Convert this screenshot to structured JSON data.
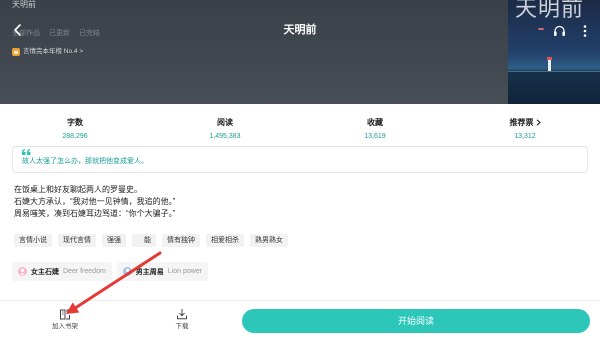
{
  "status_bar": {
    "left_text": "天明前",
    "right_icon": "signal-icon"
  },
  "header": {
    "title": "天明前",
    "back_icon": "back-arrow-icon",
    "audio_icon": "headphones-icon",
    "more_icon": "more-vertical-icon"
  },
  "author_works": {
    "tabs": [
      "全部作品",
      "已更新",
      "已完结"
    ]
  },
  "rank_badge": {
    "icon": "rank-badge-icon",
    "text": "言情完本年榜 No.4 >"
  },
  "cover": {
    "title": "天明前"
  },
  "stats": [
    {
      "label": "字数",
      "value": "288,296"
    },
    {
      "label": "阅读",
      "value": "1,495,383"
    },
    {
      "label": "收藏",
      "value": "13,619"
    },
    {
      "label": "推荐票",
      "value": "13,312",
      "icon": "chevron-right-icon"
    }
  ],
  "quote": {
    "icon": "quote-icon",
    "text": "故人太强了怎么办，那就把他变成爱人。"
  },
  "description": {
    "lines": [
      "在饭桌上和好友聊起两人的罗曼史。",
      "石婕大方承认，“我对他一见钟情，我追的他。”",
      "周易嗤笑，凑到石婕耳边骂道：“你个大骗子。”"
    ]
  },
  "tags": [
    "言情小说",
    "现代言情",
    "强强",
    "能",
    "情有独钟",
    "相爱相杀",
    "熟男熟女"
  ],
  "characters": [
    {
      "icon": "female-icon",
      "name": "女主石婕",
      "alias": "Deer freedom"
    },
    {
      "icon": "male-icon",
      "name": "男主周易",
      "alias": "Lion power"
    }
  ],
  "bottom_bar": {
    "add_to_shelf": {
      "icon": "bookshelf-add-icon",
      "label": "加入书架"
    },
    "download": {
      "icon": "download-icon",
      "label": "下载"
    },
    "start_reading": {
      "label": "开始阅读"
    }
  },
  "colors": {
    "accent": "#2cc7b9",
    "accent_text": "#1a9e96",
    "header_bg": "#40474f",
    "annotation_arrow": "#e53935"
  }
}
